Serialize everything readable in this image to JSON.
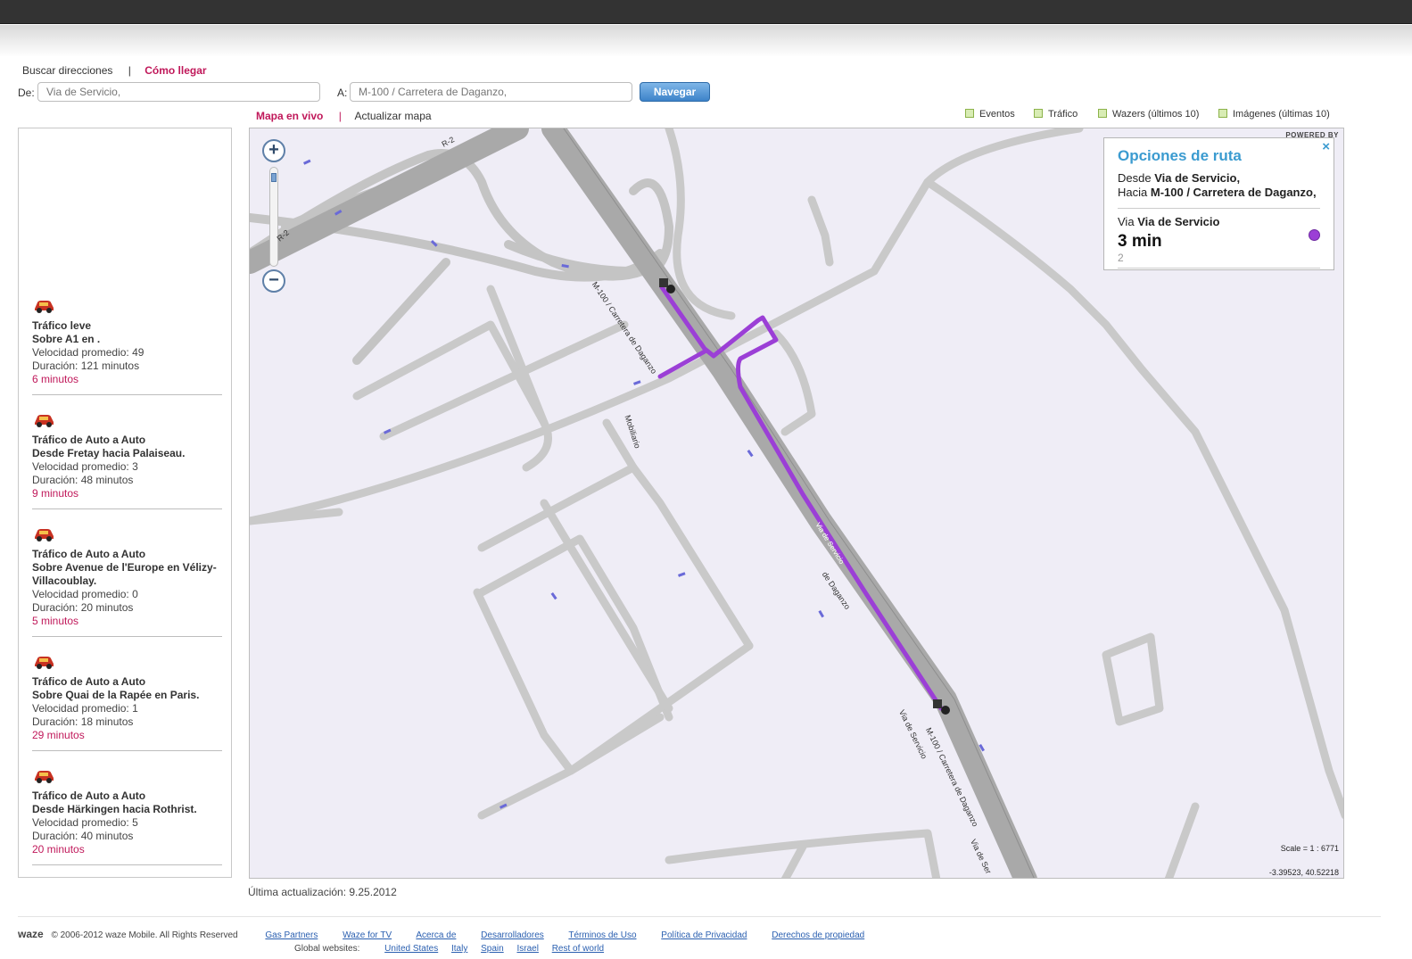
{
  "tabs": {
    "search": "Buscar direcciones",
    "separator": "|",
    "directions": "Cómo llegar"
  },
  "form": {
    "from_label": "De:",
    "from_placeholder": "Via de Servicio,",
    "to_label": "A:",
    "to_placeholder": "M-100 / Carretera de Daganzo,",
    "navigate": "Navegar"
  },
  "map_links": {
    "live": "Mapa en vivo",
    "separator": "|",
    "refresh": "Actualizar mapa"
  },
  "layers": [
    "Eventos",
    "Tráfico",
    "Wazers (últimos 10)",
    "Imágenes (últimas 10)"
  ],
  "alerts": [
    {
      "title": "Tráfico leve",
      "location": "Sobre A1 en .",
      "speed": "Velocidad promedio:  49",
      "duration": "Duración: 121 minutos",
      "ago": "6 minutos"
    },
    {
      "title": "Tráfico de Auto a Auto",
      "location": "Desde Fretay hacia Palaiseau.",
      "speed": "Velocidad promedio:  3",
      "duration": "Duración: 48 minutos",
      "ago": "9 minutos"
    },
    {
      "title": "Tráfico de Auto a Auto",
      "location": "Sobre Avenue de l'Europe en Vélizy-Villacoublay.",
      "speed": "Velocidad promedio:  0",
      "duration": "Duración: 20 minutos",
      "ago": "5 minutos"
    },
    {
      "title": "Tráfico de Auto a Auto",
      "location": "Sobre Quai de la Rapée en Paris.",
      "speed": "Velocidad promedio:  1",
      "duration": "Duración: 18 minutos",
      "ago": "29 minutos"
    },
    {
      "title": "Tráfico de Auto a Auto",
      "location": "Desde Härkingen hacia Rothrist.",
      "speed": "Velocidad promedio:  5",
      "duration": "Duración: 40 minutos",
      "ago": "20 minutos"
    }
  ],
  "route_panel": {
    "title": "Opciones de ruta",
    "from_prefix": "Desde",
    "from_value": "Via de Servicio,",
    "to_prefix": "Hacia",
    "to_value": "M-100 / Carretera de Daganzo,",
    "via_prefix": "Via",
    "via_value": "Via de Servicio",
    "time": "3 min",
    "sub": "2",
    "close": "×",
    "route_color": "#9b3fd6"
  },
  "map": {
    "powered_by": "POWERED BY",
    "scale": "Scale = 1 : 6771",
    "coords": "-3.39523, 40.52218",
    "zoom_in": "+",
    "zoom_out": "−",
    "road_labels": [
      "R-2",
      "R-2",
      "M-100 / Carretera de Daganzo",
      "de Daganzo",
      "Via de Servicio",
      "M-100 / Carretera de Daganzo",
      "Via de Ser",
      "Mobiliario",
      "Via de Servicio"
    ],
    "markers": [
      "2",
      "1"
    ]
  },
  "updated": "Última actualización: 9.25.2012",
  "footer": {
    "logo": "waze",
    "copyright": "© 2006-2012 waze Mobile. All Rights Reserved",
    "links": [
      "Gas Partners",
      "Waze for TV",
      "Acerca de",
      "Desarrolladores",
      "Términos de Uso",
      "Política de Privacidad",
      "Derechos de propiedad"
    ],
    "global_label": "Global websites:",
    "global_links": [
      "United States",
      "Italy",
      "Spain",
      "Israel",
      "Rest of world"
    ]
  }
}
